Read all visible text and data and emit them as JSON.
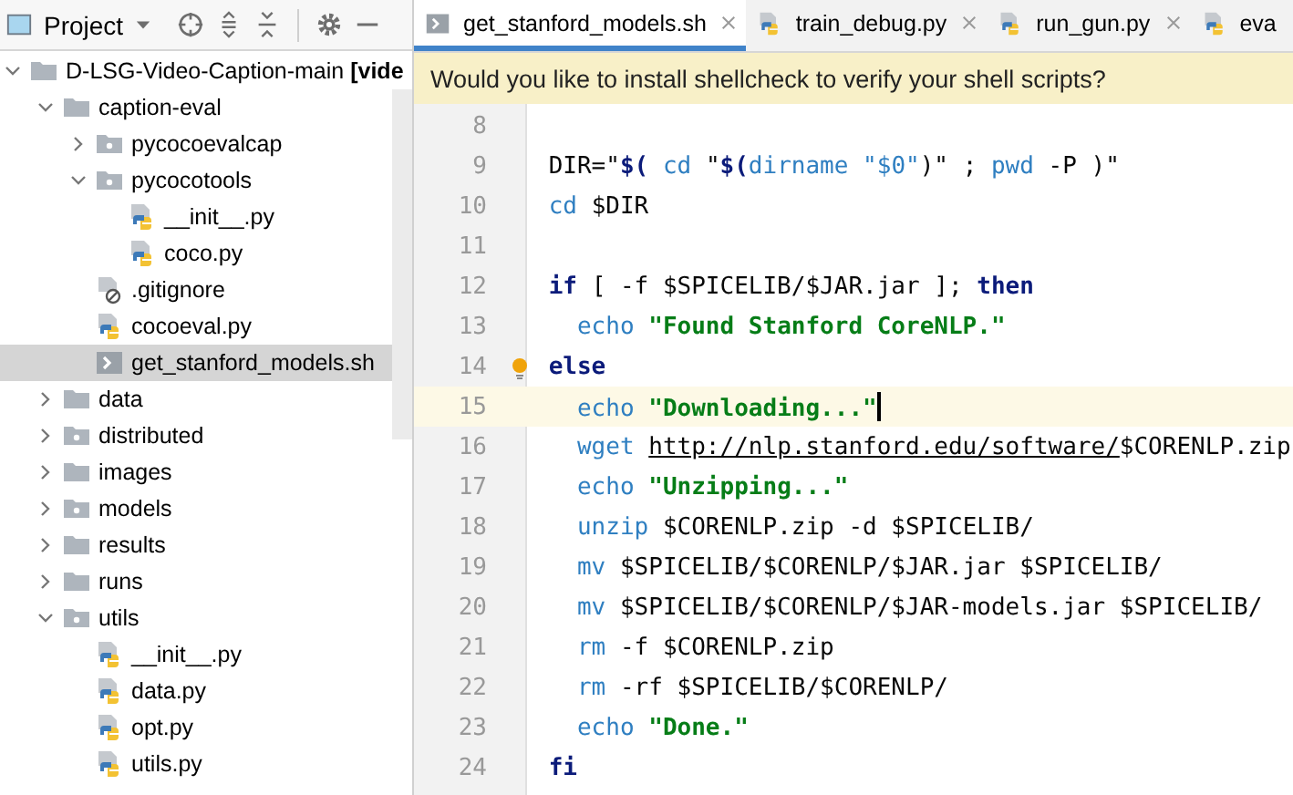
{
  "project_panel": {
    "title": "Project",
    "tree": [
      {
        "name": "D-LSG-Video-Caption-main **[vide**",
        "kind": "folder",
        "expanded": true,
        "selected": false,
        "children": [
          {
            "name": "caption-eval",
            "kind": "folder",
            "expanded": true,
            "selected": false,
            "children": [
              {
                "name": "pycocoevalcap",
                "kind": "package",
                "expanded": false,
                "selected": false
              },
              {
                "name": "pycocotools",
                "kind": "package",
                "expanded": true,
                "selected": false,
                "children": [
                  {
                    "name": "__init__.py",
                    "kind": "python",
                    "selected": false
                  },
                  {
                    "name": "coco.py",
                    "kind": "python",
                    "selected": false
                  }
                ]
              },
              {
                "name": ".gitignore",
                "kind": "ignore",
                "selected": false
              },
              {
                "name": "cocoeval.py",
                "kind": "python",
                "selected": false
              },
              {
                "name": "get_stanford_models.sh",
                "kind": "shell",
                "selected": true
              }
            ]
          },
          {
            "name": "data",
            "kind": "folder",
            "expanded": false,
            "selected": false
          },
          {
            "name": "distributed",
            "kind": "package",
            "expanded": false,
            "selected": false
          },
          {
            "name": "images",
            "kind": "folder",
            "expanded": false,
            "selected": false
          },
          {
            "name": "models",
            "kind": "package",
            "expanded": false,
            "selected": false
          },
          {
            "name": "results",
            "kind": "folder",
            "expanded": false,
            "selected": false
          },
          {
            "name": "runs",
            "kind": "folder",
            "expanded": false,
            "selected": false
          },
          {
            "name": "utils",
            "kind": "package",
            "expanded": true,
            "selected": false,
            "children": [
              {
                "name": "__init__.py",
                "kind": "python",
                "selected": false
              },
              {
                "name": "data.py",
                "kind": "python",
                "selected": false
              },
              {
                "name": "opt.py",
                "kind": "python",
                "selected": false
              },
              {
                "name": "utils.py",
                "kind": "python",
                "selected": false
              }
            ]
          }
        ]
      }
    ]
  },
  "tabs": [
    {
      "label": "get_stanford_models.sh",
      "kind": "shell",
      "selected": true,
      "closable": true
    },
    {
      "label": "train_debug.py",
      "kind": "python",
      "selected": false,
      "closable": true
    },
    {
      "label": "run_gun.py",
      "kind": "python",
      "selected": false,
      "closable": true
    },
    {
      "label": "eva",
      "kind": "python",
      "selected": false,
      "closable": false
    }
  ],
  "banner": "Would you like to install shellcheck to verify your shell scripts?",
  "code_lines": [
    {
      "number": "8",
      "current": false
    },
    {
      "number": "9",
      "current": false,
      "tokens": [
        {
          "text": "DIR=\"",
          "kind": "plain"
        },
        {
          "text": "$(",
          "kind": "keyword"
        },
        {
          "text": " cd ",
          "kind": "command"
        },
        {
          "text": "\"",
          "kind": "plain"
        },
        {
          "text": "$(",
          "kind": "keyword"
        },
        {
          "text": "dirname \"$0\"",
          "kind": "command"
        },
        {
          "text": ")\" ; ",
          "kind": "plain"
        },
        {
          "text": "pwd",
          "kind": "command"
        },
        {
          "text": " -P )\"",
          "kind": "plain"
        }
      ]
    },
    {
      "number": "10",
      "current": false,
      "tokens": [
        {
          "text": "cd",
          "kind": "command"
        },
        {
          "text": " $DIR",
          "kind": "plain"
        }
      ]
    },
    {
      "number": "11",
      "current": false
    },
    {
      "number": "12",
      "current": false,
      "tokens": [
        {
          "text": "if",
          "kind": "keyword"
        },
        {
          "text": " [ -f $SPICELIB/$JAR.jar ]; ",
          "kind": "plain"
        },
        {
          "text": "then",
          "kind": "keyword"
        }
      ]
    },
    {
      "number": "13",
      "current": false,
      "tokens": [
        {
          "text": "  echo ",
          "kind": "command"
        },
        {
          "text": "\"Found Stanford CoreNLP.\"",
          "kind": "string"
        }
      ]
    },
    {
      "number": "14",
      "current": false,
      "bulb": true,
      "tokens": [
        {
          "text": "else",
          "kind": "keyword"
        }
      ]
    },
    {
      "number": "15",
      "current": true,
      "caret": true,
      "tokens": [
        {
          "text": "  echo ",
          "kind": "command"
        },
        {
          "text": "\"Downloading...\"",
          "kind": "string"
        }
      ]
    },
    {
      "number": "16",
      "current": false,
      "tokens": [
        {
          "text": "  wget ",
          "kind": "command"
        },
        {
          "text": "http://nlp.stanford.edu/software/",
          "kind": "url"
        },
        {
          "text": "$CORENLP.zip",
          "kind": "plain"
        }
      ]
    },
    {
      "number": "17",
      "current": false,
      "tokens": [
        {
          "text": "  echo ",
          "kind": "command"
        },
        {
          "text": "\"Unzipping...\"",
          "kind": "string"
        }
      ]
    },
    {
      "number": "18",
      "current": false,
      "tokens": [
        {
          "text": "  unzip ",
          "kind": "command"
        },
        {
          "text": "$CORENLP.zip -d $SPICELIB/",
          "kind": "plain"
        }
      ]
    },
    {
      "number": "19",
      "current": false,
      "tokens": [
        {
          "text": "  mv ",
          "kind": "command"
        },
        {
          "text": "$SPICELIB/$CORENLP/$JAR.jar $SPICELIB/",
          "kind": "plain"
        }
      ]
    },
    {
      "number": "20",
      "current": false,
      "tokens": [
        {
          "text": "  mv ",
          "kind": "command"
        },
        {
          "text": "$SPICELIB/$CORENLP/$JAR-models.jar $SPICELIB/",
          "kind": "plain"
        }
      ]
    },
    {
      "number": "21",
      "current": false,
      "tokens": [
        {
          "text": "  rm ",
          "kind": "command"
        },
        {
          "text": "-f $CORENLP.zip",
          "kind": "plain"
        }
      ]
    },
    {
      "number": "22",
      "current": false,
      "tokens": [
        {
          "text": "  rm ",
          "kind": "command"
        },
        {
          "text": "-rf $SPICELIB/$CORENLP/",
          "kind": "plain"
        }
      ]
    },
    {
      "number": "23",
      "current": false,
      "tokens": [
        {
          "text": "  echo ",
          "kind": "command"
        },
        {
          "text": "\"Done.\"",
          "kind": "string"
        }
      ]
    },
    {
      "number": "24",
      "current": false,
      "tokens": [
        {
          "text": "fi",
          "kind": "keyword"
        }
      ]
    }
  ]
}
